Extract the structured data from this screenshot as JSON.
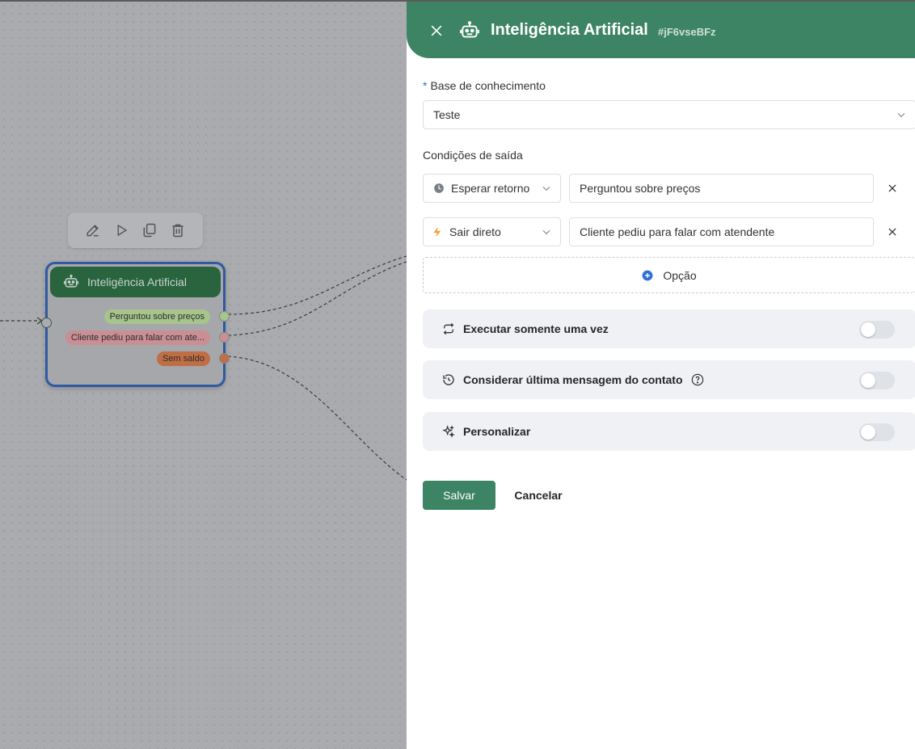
{
  "canvas": {
    "toolbar": {
      "edit_icon": "edit-icon",
      "play_icon": "play-icon",
      "copy_icon": "copy-icon",
      "delete_icon": "trash-icon"
    },
    "node": {
      "title": "Inteligência Artificial",
      "icon": "robot-icon",
      "conditions": [
        {
          "label": "Perguntou sobre preços",
          "color": "#a6c48c"
        },
        {
          "label": "Cliente pediu para falar com ate...",
          "color": "#c98f95"
        },
        {
          "label": "Sem saldo",
          "color": "#bf6e45"
        }
      ]
    }
  },
  "drawer": {
    "title": "Inteligência Artificial",
    "node_id": "#jF6vseBFz",
    "header_color": "#3c8463",
    "knowledge_base": {
      "required_mark": "*",
      "label": "Base de conhecimento",
      "value": "Teste"
    },
    "exit_conditions": {
      "label": "Condições de saída",
      "rows": [
        {
          "type": "Esperar retorno",
          "type_icon": "clock-icon",
          "value": "Perguntou sobre preços"
        },
        {
          "type": "Sair direto",
          "type_icon": "lightning-icon",
          "value": "Cliente pediu para falar com atendente"
        }
      ],
      "add_label": "Opção"
    },
    "options": [
      {
        "label": "Executar somente uma vez",
        "icon": "repeat-icon",
        "enabled": false
      },
      {
        "label": "Considerar última mensagem do contato",
        "icon": "history-icon",
        "help_icon": "help-icon",
        "enabled": false
      },
      {
        "label": "Personalizar",
        "icon": "sparkles-icon",
        "enabled": false
      }
    ],
    "actions": {
      "save_label": "Salvar",
      "cancel_label": "Cancelar"
    }
  }
}
